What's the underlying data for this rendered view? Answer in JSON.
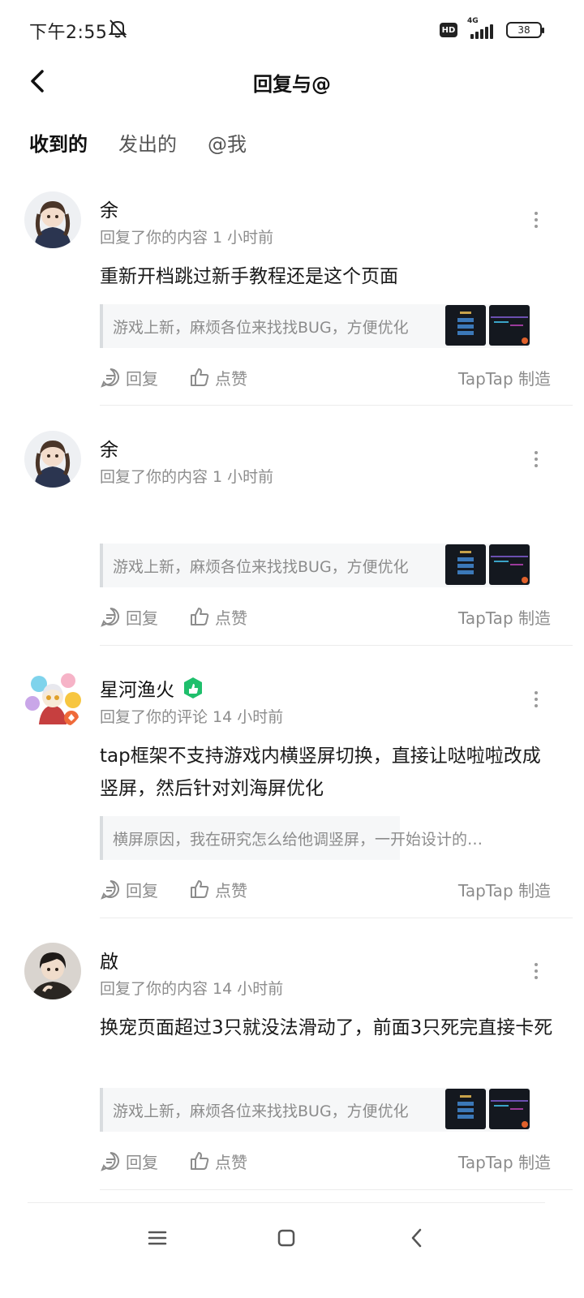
{
  "status_bar": {
    "time": "下午2:55",
    "hd": "HD",
    "network": "4G",
    "battery": "38"
  },
  "header": {
    "title": "回复与@"
  },
  "tabs": [
    {
      "label": "收到的",
      "active": true
    },
    {
      "label": "发出的",
      "active": false
    },
    {
      "label": "@我",
      "active": false
    }
  ],
  "colors": {
    "accent": "#16c6b8",
    "verified": "#1fbf6c"
  },
  "common": {
    "reply_label": "回复",
    "like_label": "点赞",
    "maker_label": "TapTap 制造"
  },
  "notifications": [
    {
      "name": "余",
      "meta": "回复了你的内容 1 小时前",
      "content": "重新开档跳过新手教程还是这个页面",
      "quote": "游戏上新，麻烦各位来找找BUG，方便优化",
      "has_thumbs": true
    },
    {
      "name": "余",
      "meta": "回复了你的内容 1 小时前",
      "content": "",
      "quote": "游戏上新，麻烦各位来找找BUG，方便优化",
      "has_thumbs": true
    },
    {
      "name": "星河渔火",
      "meta": "回复了你的评论 14 小时前",
      "content": "tap框架不支持游戏内横竖屏切换，直接让哒啦啦改成竖屏，然后针对刘海屏优化",
      "quote": "横屏原因，我在研究怎么给他调竖屏，一开始设计的…",
      "has_thumbs": false,
      "verified": true
    },
    {
      "name": "啟",
      "meta": "回复了你的内容 14 小时前",
      "content": "换宠页面超过3只就没法滑动了，前面3只死完直接卡死",
      "quote": "游戏上新，麻烦各位来找找BUG，方便优化",
      "has_thumbs": true
    }
  ]
}
